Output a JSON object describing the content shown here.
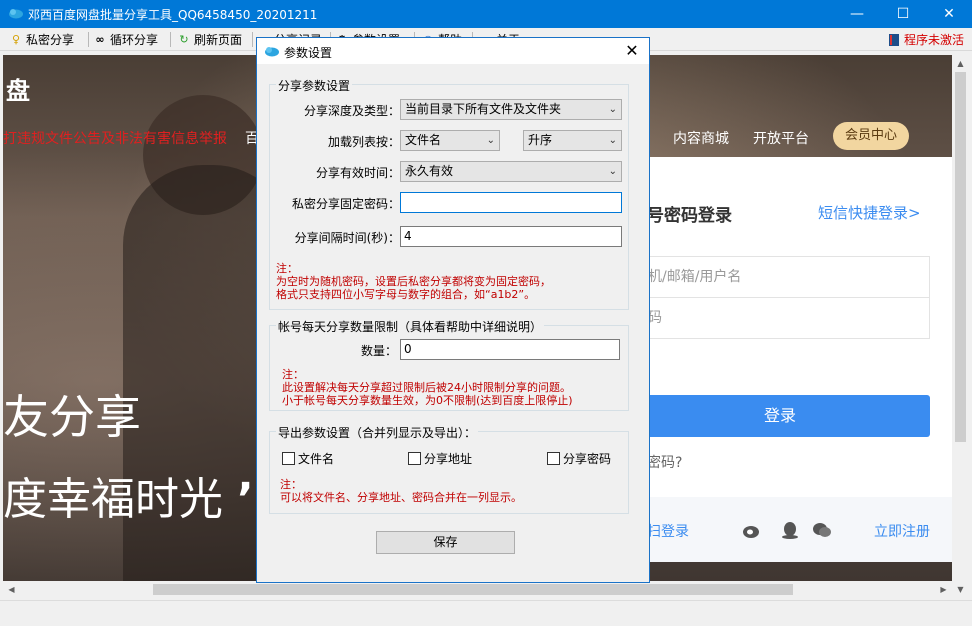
{
  "window": {
    "title": "邓西百度网盘批量分享工具_QQ6458450_20201211",
    "min_glyph": "—",
    "max_glyph": "☐",
    "close_glyph": "✕"
  },
  "toolbar": {
    "items": [
      {
        "label": "私密分享",
        "icon": "key-icon",
        "glyph": "♀"
      },
      {
        "label": "循环分享",
        "icon": "infinity-icon",
        "glyph": "∞"
      },
      {
        "label": "刷新页面",
        "icon": "refresh-icon",
        "glyph": "↻"
      },
      {
        "label": "分享记录",
        "icon": "list-icon",
        "glyph": "≡"
      },
      {
        "label": "参数设置",
        "icon": "gear-icon",
        "glyph": "⚙"
      },
      {
        "label": "帮助",
        "icon": "help-icon",
        "glyph": "◉"
      },
      {
        "label": "关于",
        "icon": "cloud-icon",
        "glyph": "☁"
      }
    ],
    "status": "程序未激活"
  },
  "web": {
    "logo": "盘",
    "notice": "打违规文件公告及非法有害信息举报",
    "nav0": "百",
    "nav": [
      "内容商城",
      "开放平台"
    ],
    "vip": "会员中心",
    "hero1": "友分享",
    "hero2": "度幸福时光",
    "hero2_quote": "’’",
    "login": {
      "title": "号密码登录",
      "sms": "短信快捷登录>",
      "user_placeholder": "机/邮箱/用户名",
      "pass_placeholder": "码",
      "button": "登录",
      "forgot": "密码?",
      "qr": "扫登录",
      "register": "立即注册"
    }
  },
  "dialog": {
    "title": "参数设置",
    "close_glyph": "✕",
    "share_group": {
      "label": "分享参数设置",
      "depth_label": "分享深度及类型：",
      "depth_value": "当前目录下所有文件及文件夹",
      "list_label": "加载列表按：",
      "list_value": "文件名",
      "order_value": "升序",
      "validity_label": "分享有效时间：",
      "validity_value": "永久有效",
      "password_label": "私密分享固定密码：",
      "password_value": "",
      "interval_label": "分享间隔时间(秒)：",
      "interval_value": "4",
      "note": [
        "注：",
        "为空时为随机密码，设置后私密分享都将变为固定密码，",
        "格式只支持四位小写字母与数字的组合，如“a1b2”。"
      ]
    },
    "limit_group": {
      "label": "帐号每天分享数量限制（具体看帮助中详细说明）",
      "count_label": "数量：",
      "count_value": "0",
      "note": [
        "注：",
        "此设置解决每天分享超过限制后被24小时限制分享的问题。",
        "小于帐号每天分享数量生效，为0不限制(达到百度上限停止)"
      ]
    },
    "export_group": {
      "label": "导出参数设置（合并列显示及导出）：",
      "options": [
        "文件名",
        "分享地址",
        "分享密码"
      ],
      "note": [
        "注：",
        "可以将文件名、分享地址、密码合并在一列显示。"
      ]
    },
    "save": "保存"
  },
  "colors": {
    "titlebar": "#0078d7",
    "accent_blue": "#3a8cf0",
    "note_red": "#c00000",
    "activation_red": "#d40000"
  }
}
